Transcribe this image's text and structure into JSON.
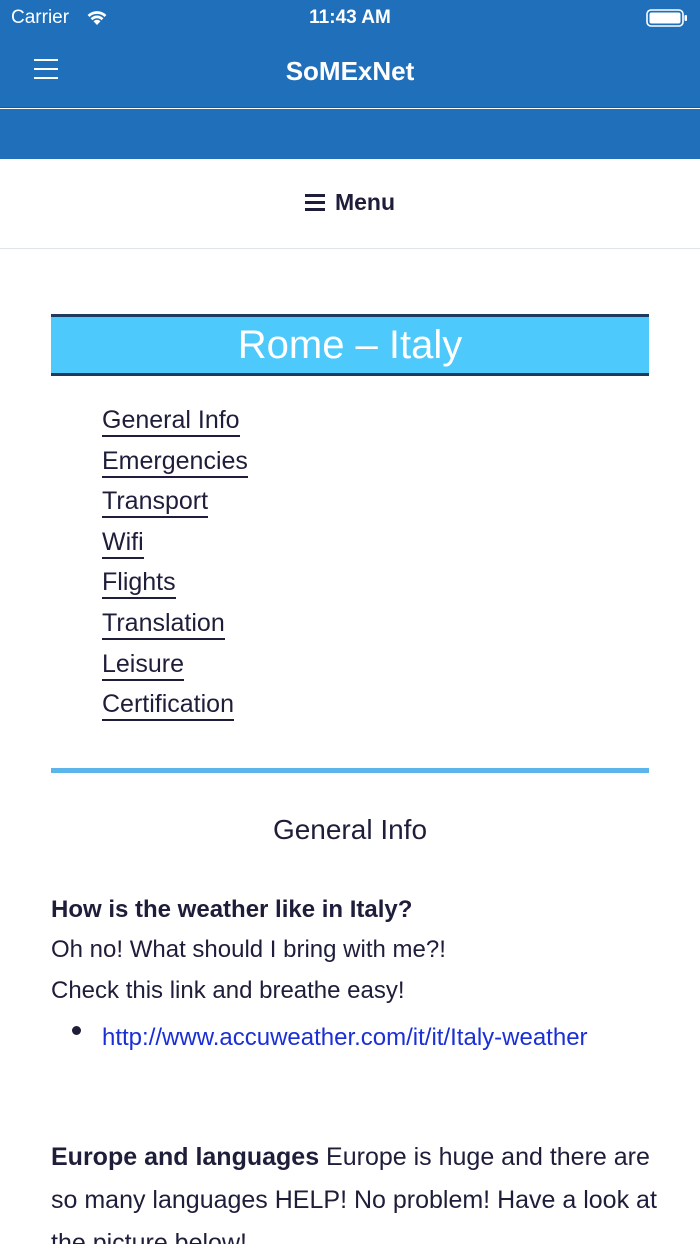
{
  "status_bar": {
    "carrier": "Carrier",
    "time": "11:43 AM"
  },
  "nav": {
    "title": "SoMExNet"
  },
  "menu": {
    "label": "Menu"
  },
  "page": {
    "title": "Rome – Italy",
    "links": [
      "General Info",
      "Emergencies",
      "Transport",
      "Wifi",
      "Flights",
      "Translation",
      "Leisure",
      "Certification"
    ],
    "section_heading": "General Info",
    "weather_question": "How is the weather like in Italy?",
    "line_2": "Oh no! What should I bring with me?!",
    "line_3": "Check this link and breathe easy!",
    "weather_link": "http://www.accuweather.com/it/it/Italy-weather",
    "europe_bold": "Europe and languages",
    "europe_text": " Europe is huge and there are so many languages HELP! No problem! Have a look at the picture below!"
  },
  "colors": {
    "brand_blue": "#1f6fba",
    "banner_blue": "#4ec9fb",
    "link_blue": "#1a2fd6"
  },
  "icons": [
    "wifi-icon",
    "battery-icon",
    "hamburger-icon",
    "menu-icon"
  ]
}
